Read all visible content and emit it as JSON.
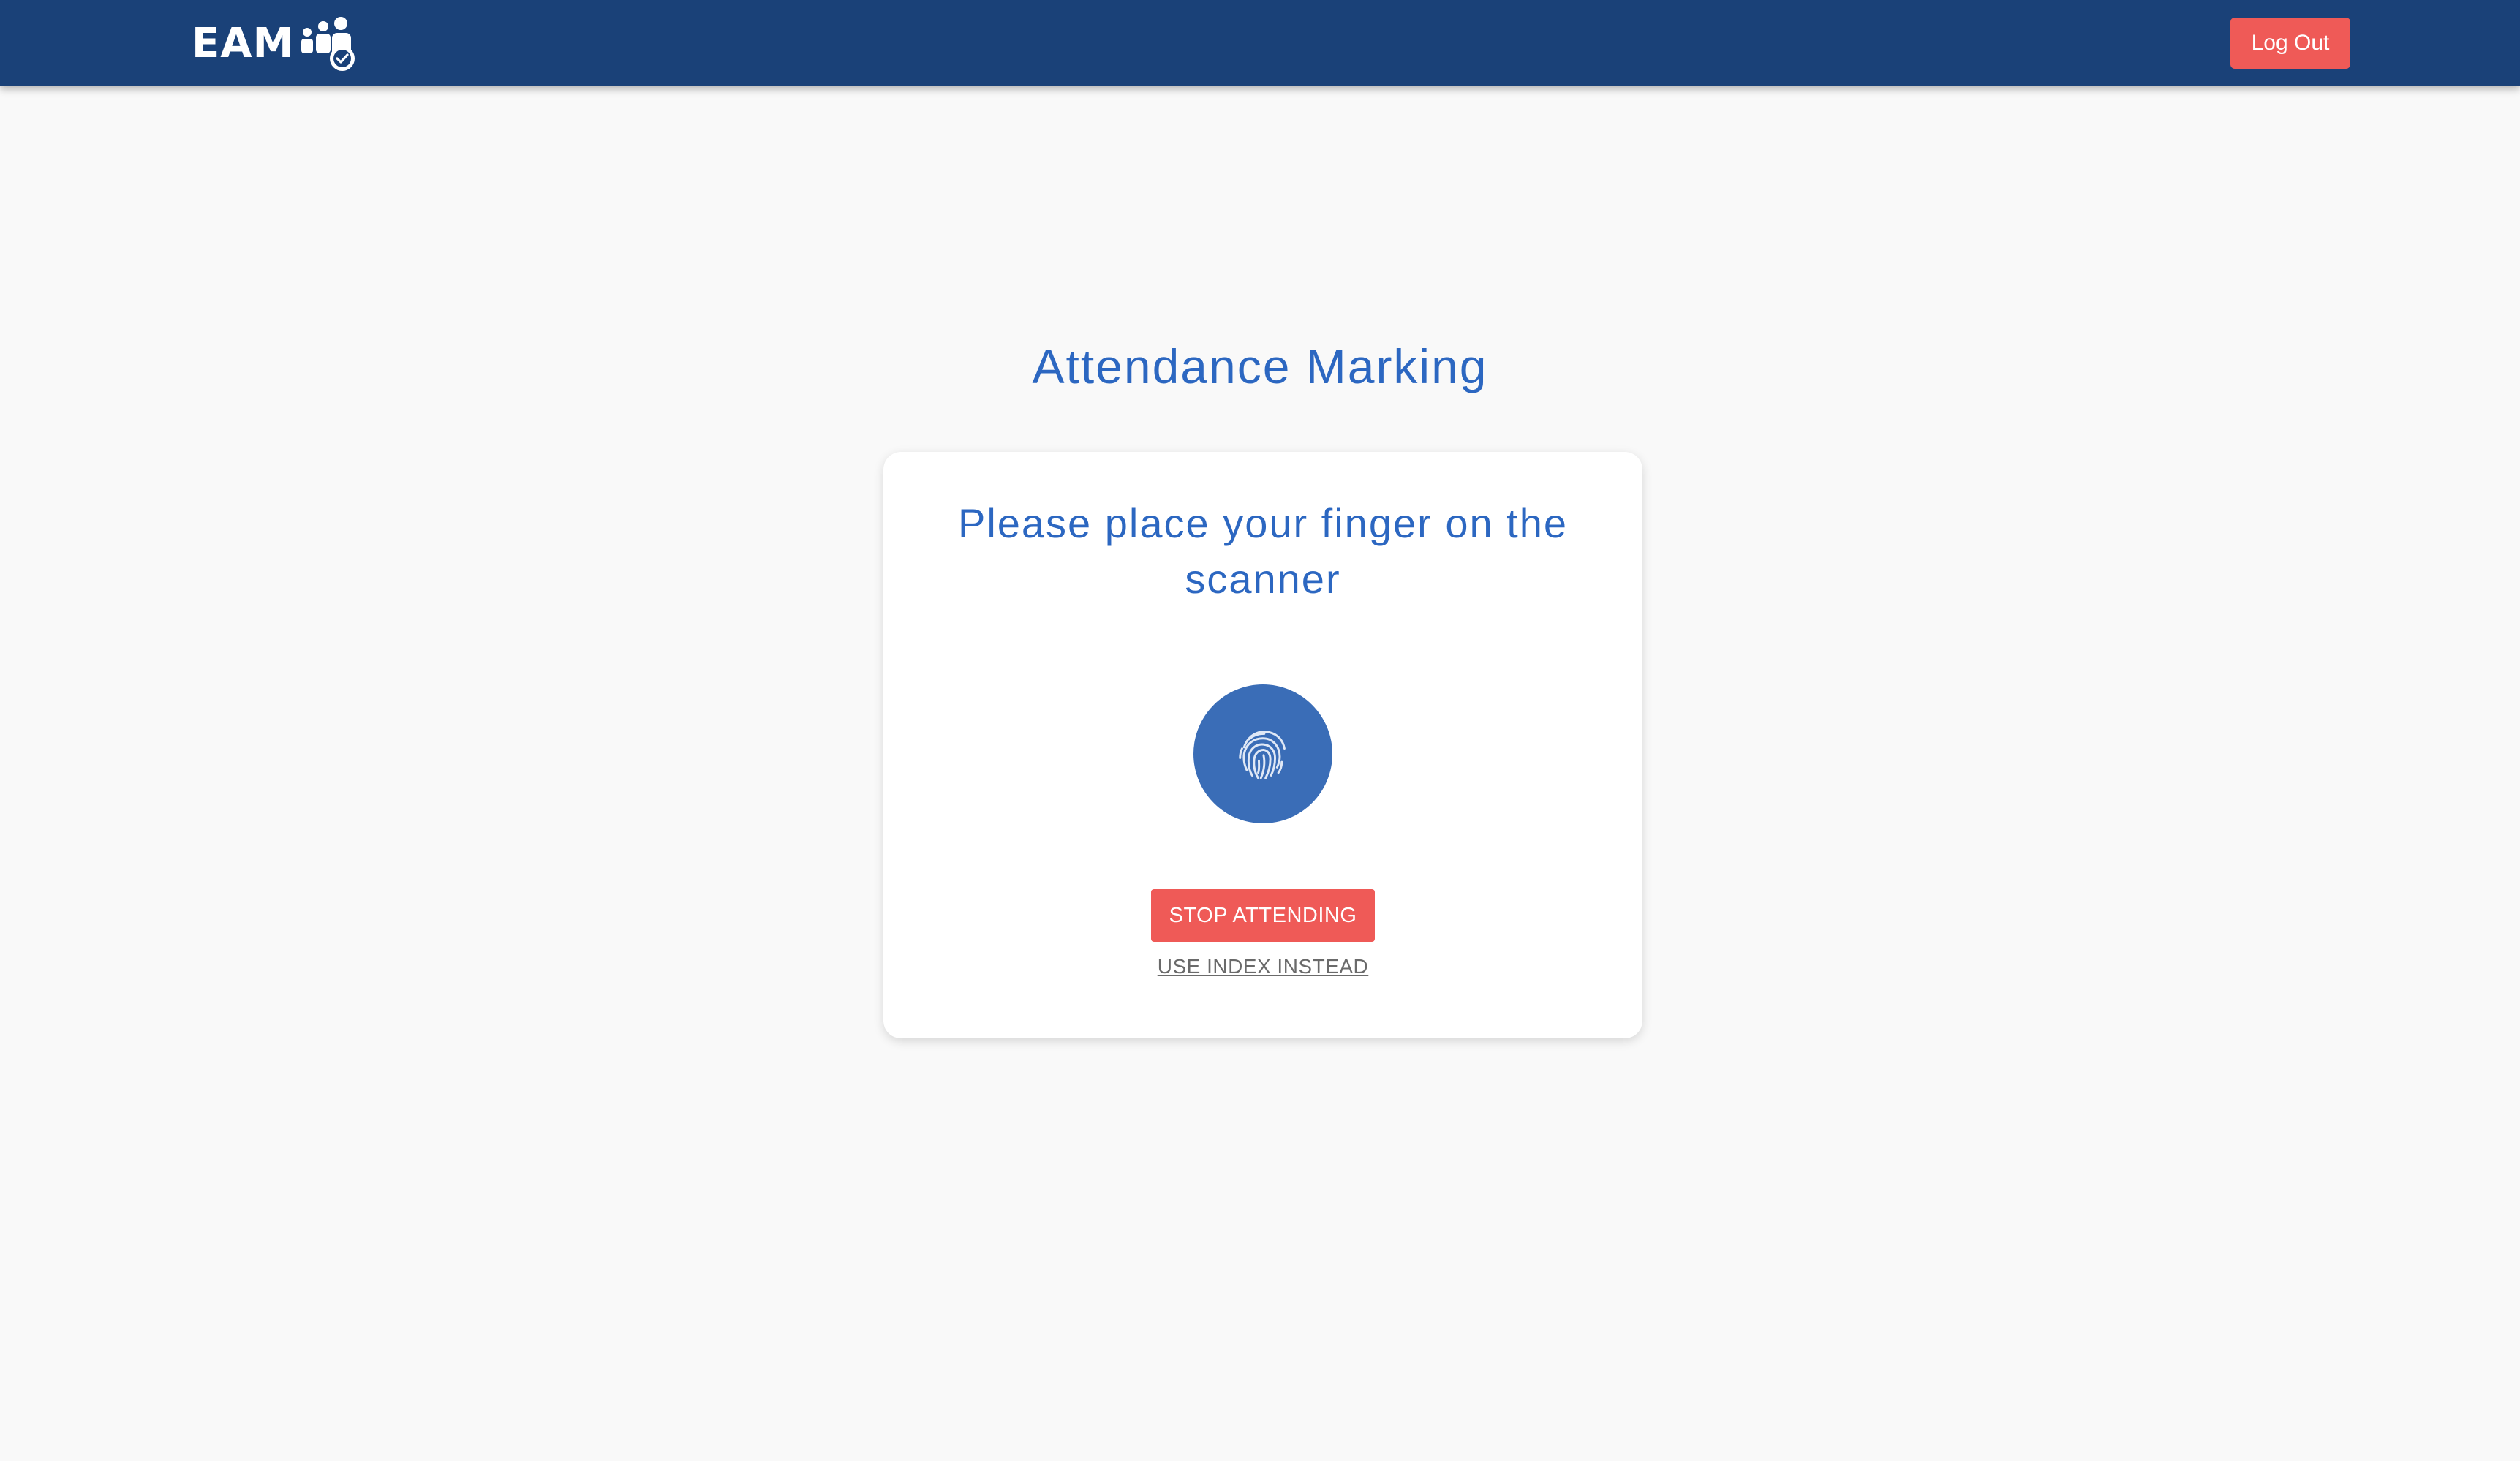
{
  "header": {
    "logo_text": "EAM",
    "logo_icon": "group-check-icon",
    "logout_label": "Log Out",
    "background_color": "#1a4178"
  },
  "main": {
    "title": "Attendance Marking",
    "card": {
      "instruction": "Please place your finger on the scanner",
      "scanner_icon": "fingerprint-icon",
      "stop_label": "STOP ATTENDING",
      "alt_link_label": "USE INDEX INSTEAD"
    }
  },
  "colors": {
    "accent_blue": "#2c67c1",
    "scanner_blue": "#3a6db7",
    "danger_red": "#ef5a57",
    "page_background": "#f9f9f9"
  }
}
